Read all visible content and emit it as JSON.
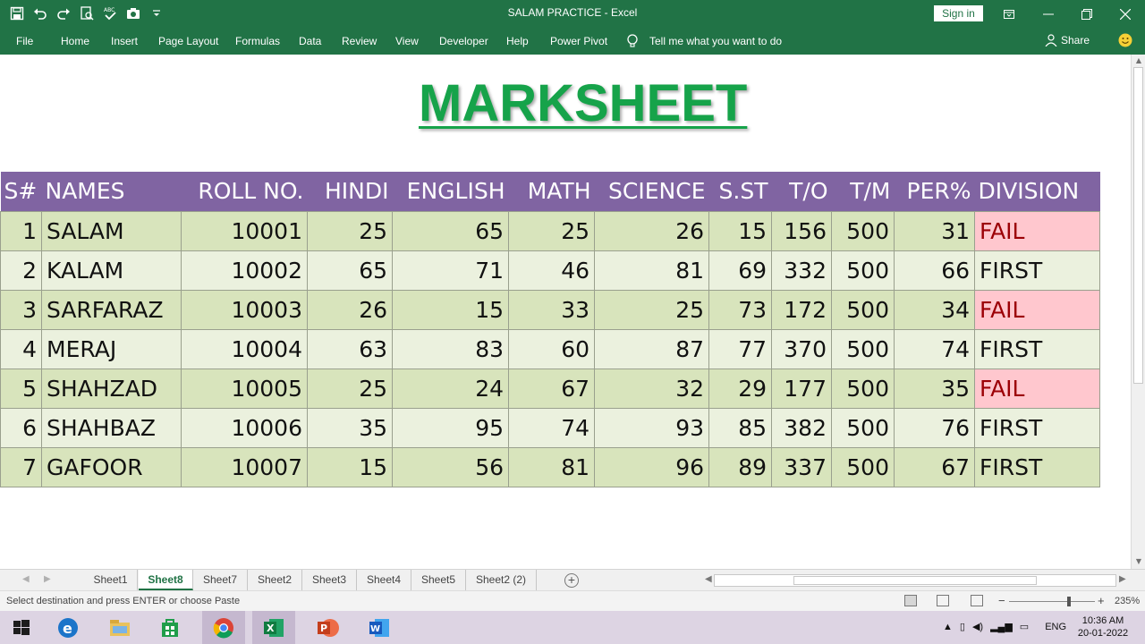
{
  "window": {
    "title": "SALAM PRACTICE  -  Excel",
    "signin_label": "Sign in"
  },
  "ribbon": {
    "tabs": [
      "File",
      "Home",
      "Insert",
      "Page Layout",
      "Formulas",
      "Data",
      "Review",
      "View",
      "Developer",
      "Help",
      "Power Pivot"
    ],
    "tell_me": "Tell me what you want to do",
    "share": "Share"
  },
  "sheet": {
    "title": "MARKSHEET",
    "title_color": "#16a34a",
    "header_bg": "#8064a2",
    "fail_bg": "#ffc7ce",
    "fail_text": "#9c0006",
    "headers": [
      "S#",
      "NAMES",
      "ROLL NO.",
      "HINDI",
      "ENGLISH",
      "MATH",
      "SCIENCE",
      "S.ST",
      "T/O",
      "T/M",
      "PER%",
      "DIVISION"
    ],
    "rows": [
      [
        "1",
        "SALAM",
        "10001",
        "25",
        "65",
        "25",
        "26",
        "15",
        "156",
        "500",
        "31",
        "FAIL"
      ],
      [
        "2",
        "KALAM",
        "10002",
        "65",
        "71",
        "46",
        "81",
        "69",
        "332",
        "500",
        "66",
        "FIRST"
      ],
      [
        "3",
        "SARFARAZ",
        "10003",
        "26",
        "15",
        "33",
        "25",
        "73",
        "172",
        "500",
        "34",
        "FAIL"
      ],
      [
        "4",
        "MERAJ",
        "10004",
        "63",
        "83",
        "60",
        "87",
        "77",
        "370",
        "500",
        "74",
        "FIRST"
      ],
      [
        "5",
        "SHAHZAD",
        "10005",
        "25",
        "24",
        "67",
        "32",
        "29",
        "177",
        "500",
        "35",
        "FAIL"
      ],
      [
        "6",
        "SHAHBAZ",
        "10006",
        "35",
        "95",
        "74",
        "93",
        "85",
        "382",
        "500",
        "76",
        "FIRST"
      ],
      [
        "7",
        "GAFOOR",
        "10007",
        "15",
        "56",
        "81",
        "96",
        "89",
        "337",
        "500",
        "67",
        "FIRST"
      ]
    ]
  },
  "sheet_tabs": [
    "Sheet1",
    "Sheet8",
    "Sheet7",
    "Sheet2",
    "Sheet3",
    "Sheet4",
    "Sheet5",
    "Sheet2 (2)"
  ],
  "active_sheet": "Sheet8",
  "status": {
    "message": "Select destination and press ENTER or choose Paste",
    "zoom": "235%"
  },
  "taskbar": {
    "apps": [
      "start-icon",
      "edge-icon",
      "file-explorer-icon",
      "store-icon",
      "chrome-icon",
      "excel-icon",
      "powerpoint-icon",
      "word-icon"
    ],
    "language": "ENG",
    "time": "10:36 AM",
    "date": "20-01-2022"
  }
}
